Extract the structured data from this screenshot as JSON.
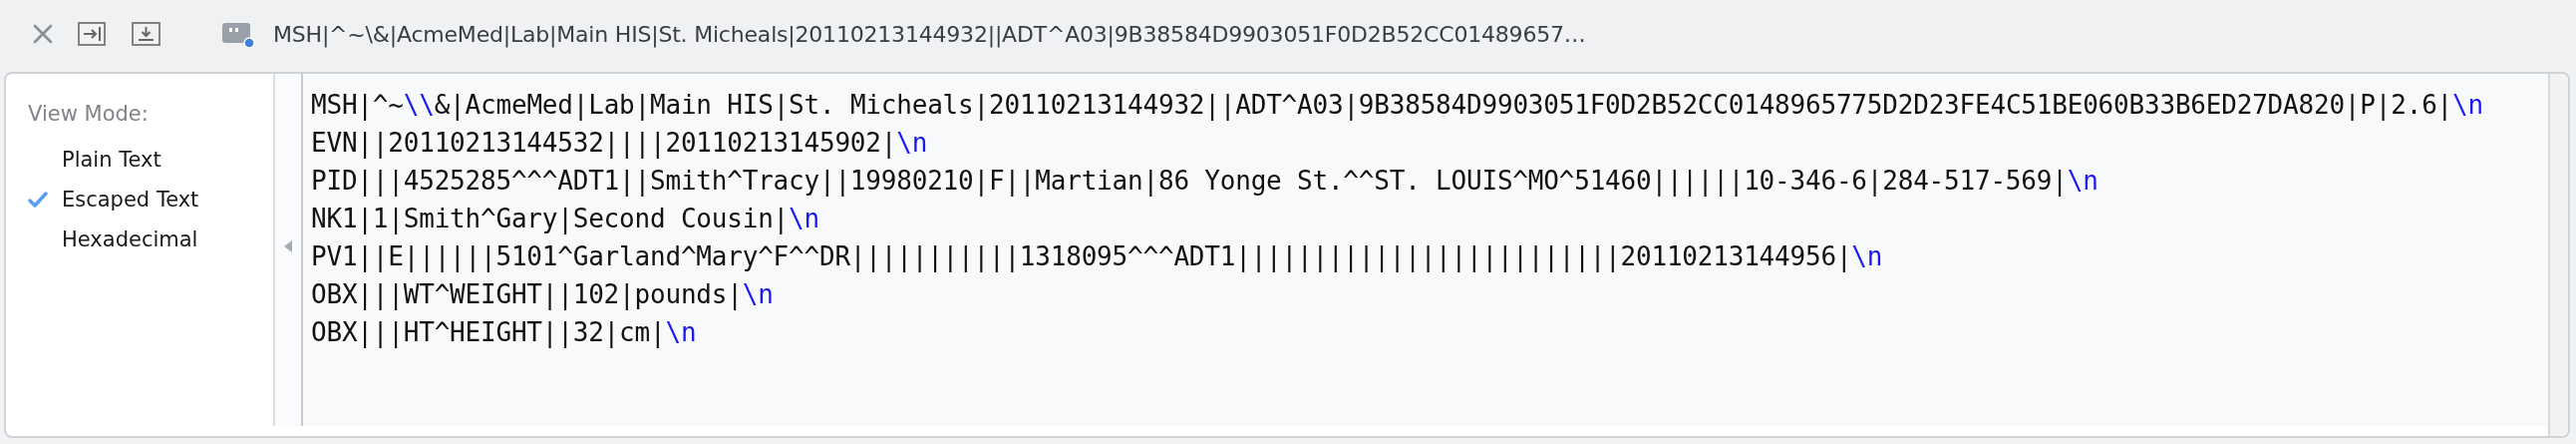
{
  "toolbar": {
    "message_title": "MSH|^~\\&|AcmeMed|Lab|Main HIS|St. Micheals|20110213144932||ADT^A03|9B38584D9903051F0D2B52CC01489657…"
  },
  "view_mode": {
    "label": "View Mode:",
    "options": [
      {
        "label": "Plain Text",
        "selected": false
      },
      {
        "label": "Escaped Text",
        "selected": true
      },
      {
        "label": "Hexadecimal",
        "selected": false
      }
    ]
  },
  "content": {
    "lines": [
      {
        "segments": [
          {
            "kind": "plain",
            "text": "MSH|^~"
          },
          {
            "kind": "escape",
            "text": "\\\\"
          },
          {
            "kind": "plain",
            "text": "&|AcmeMed|Lab|Main HIS|St. Micheals|20110213144932||ADT^A03|9B38584D9903051F0D2B52CC0148965775D2D23FE4C51BE060B33B6ED27DA820|P|2.6|"
          },
          {
            "kind": "escape",
            "text": "\\n"
          }
        ]
      },
      {
        "segments": [
          {
            "kind": "plain",
            "text": "EVN||20110213144532||||20110213145902|"
          },
          {
            "kind": "escape",
            "text": "\\n"
          }
        ]
      },
      {
        "segments": [
          {
            "kind": "plain",
            "text": "PID|||4525285^^^ADT1||Smith^Tracy||19980210|F||Martian|86 Yonge St.^^ST. LOUIS^MO^51460||||||10-346-6|284-517-569|"
          },
          {
            "kind": "escape",
            "text": "\\n"
          }
        ]
      },
      {
        "segments": [
          {
            "kind": "plain",
            "text": "NK1|1|Smith^Gary|Second Cousin|"
          },
          {
            "kind": "escape",
            "text": "\\n"
          }
        ]
      },
      {
        "segments": [
          {
            "kind": "plain",
            "text": "PV1||E||||||5101^Garland^Mary^F^^DR|||||||||||1318095^^^ADT1|||||||||||||||||||||||||20110213144956|"
          },
          {
            "kind": "escape",
            "text": "\\n"
          }
        ]
      },
      {
        "segments": [
          {
            "kind": "plain",
            "text": "OBX|||WT^WEIGHT||102|pounds|"
          },
          {
            "kind": "escape",
            "text": "\\n"
          }
        ]
      },
      {
        "segments": [
          {
            "kind": "plain",
            "text": "OBX|||HT^HEIGHT||32|cm|"
          },
          {
            "kind": "escape",
            "text": "\\n"
          }
        ]
      }
    ]
  }
}
